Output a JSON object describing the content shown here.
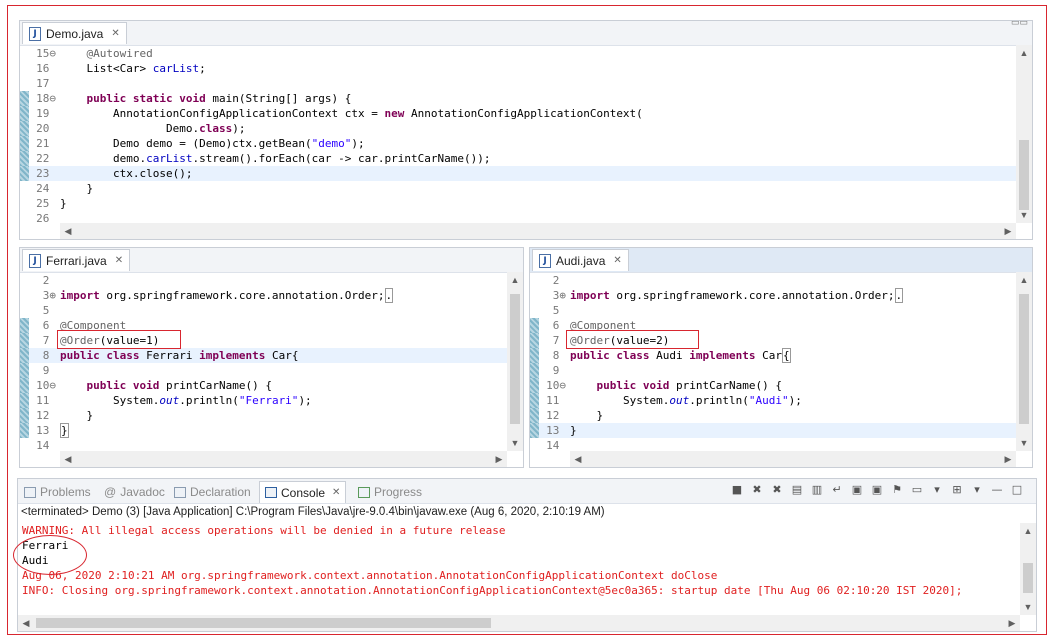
{
  "top_editor": {
    "tab": "Demo.java",
    "lines": [
      {
        "n": "15",
        "fold": "⊖",
        "html": "    <span class='an'>@Autowired</span>"
      },
      {
        "n": "16",
        "fold": "",
        "html": "    List&lt;Car&gt; <span class='fld'>carList</span>;"
      },
      {
        "n": "17",
        "fold": "",
        "html": ""
      },
      {
        "n": "18",
        "fold": "⊖",
        "html": "    <span class='kw'>public static void</span> main(String[] args) {"
      },
      {
        "n": "19",
        "fold": "",
        "html": "        AnnotationConfigApplicationContext ctx = <span class='kw'>new</span> AnnotationConfigApplicationContext("
      },
      {
        "n": "20",
        "fold": "",
        "html": "                Demo.<span class='kw'>class</span>);"
      },
      {
        "n": "21",
        "fold": "",
        "html": "        Demo demo = (Demo)ctx.getBean(<span class='str'>\"demo\"</span>);"
      },
      {
        "n": "22",
        "fold": "",
        "html": "        demo.<span class='fld'>carList</span>.stream().forEach(car -&gt; car.printCarName());"
      },
      {
        "n": "23",
        "fold": "",
        "html": "        ctx.close();"
      },
      {
        "n": "24",
        "fold": "",
        "html": "    }"
      },
      {
        "n": "25",
        "fold": "",
        "html": "}"
      },
      {
        "n": "26",
        "fold": "",
        "html": ""
      }
    ]
  },
  "ferrari_editor": {
    "tab": "Ferrari.java",
    "lines": [
      {
        "n": "2",
        "fold": "",
        "html": ""
      },
      {
        "n": "3",
        "fold": "⊕",
        "html": "<span class='kw'>import</span> org.springframework.core.annotation.Order;<span style='border:1px solid #999'>.</span>"
      },
      {
        "n": "5",
        "fold": "",
        "html": ""
      },
      {
        "n": "6",
        "fold": "",
        "html": "<span class='an'>@Component</span>"
      },
      {
        "n": "7",
        "fold": "",
        "html": "<span class='an'>@Order</span>(value=1)"
      },
      {
        "n": "8",
        "fold": "",
        "html": "<span class='kw'>public class</span> Ferrari <span class='kw'>implements</span> Car{"
      },
      {
        "n": "9",
        "fold": "",
        "html": ""
      },
      {
        "n": "10",
        "fold": "⊖",
        "html": "    <span class='kw'>public void</span> printCarName() {"
      },
      {
        "n": "11",
        "fold": "",
        "html": "        System.<span class='fld it'>out</span>.println(<span class='str'>\"Ferrari\"</span>);"
      },
      {
        "n": "12",
        "fold": "",
        "html": "    }"
      },
      {
        "n": "13",
        "fold": "",
        "html": "<span style='border:1px solid #999'>}</span>"
      },
      {
        "n": "14",
        "fold": "",
        "html": ""
      }
    ]
  },
  "audi_editor": {
    "tab": "Audi.java",
    "lines": [
      {
        "n": "2",
        "fold": "",
        "html": ""
      },
      {
        "n": "3",
        "fold": "⊕",
        "html": "<span class='kw'>import</span> org.springframework.core.annotation.Order;<span style='border:1px solid #999'>.</span>"
      },
      {
        "n": "5",
        "fold": "",
        "html": ""
      },
      {
        "n": "6",
        "fold": "",
        "html": "<span class='an'>@Component</span>"
      },
      {
        "n": "7",
        "fold": "",
        "html": "<span class='an'>@Order</span>(value=2)"
      },
      {
        "n": "8",
        "fold": "",
        "html": "<span class='kw'>public class</span> Audi <span class='kw'>implements</span> Car<span style='border:1px solid #999'>{</span>"
      },
      {
        "n": "9",
        "fold": "",
        "html": ""
      },
      {
        "n": "10",
        "fold": "⊖",
        "html": "    <span class='kw'>public void</span> printCarName() {"
      },
      {
        "n": "11",
        "fold": "",
        "html": "        System.<span class='fld it'>out</span>.println(<span class='str'>\"Audi\"</span>);"
      },
      {
        "n": "12",
        "fold": "",
        "html": "    }"
      },
      {
        "n": "13",
        "fold": "",
        "html": "}"
      },
      {
        "n": "14",
        "fold": "",
        "html": ""
      }
    ]
  },
  "bottom_panel": {
    "tabs": [
      "Problems",
      "Javadoc",
      "Declaration",
      "Console",
      "Progress"
    ],
    "tab_prefix_javadoc": "@",
    "status": "<terminated> Demo (3) [Java Application] C:\\Program Files\\Java\\jre-9.0.4\\bin\\javaw.exe (Aug 6, 2020, 2:10:19 AM)",
    "console_lines": [
      {
        "cls": "red",
        "text": "WARNING: All illegal access operations will be denied in a future release"
      },
      {
        "cls": "blk",
        "text": "Ferrari"
      },
      {
        "cls": "blk",
        "text": "Audi"
      },
      {
        "cls": "red",
        "text": "Aug 06, 2020 2:10:21 AM org.springframework.context.annotation.AnnotationConfigApplicationContext doClose"
      },
      {
        "cls": "red",
        "text": "INFO: Closing org.springframework.context.annotation.AnnotationConfigApplicationContext@5ec0a365: startup date [Thu Aug 06 02:10:20 IST 2020];"
      }
    ]
  }
}
